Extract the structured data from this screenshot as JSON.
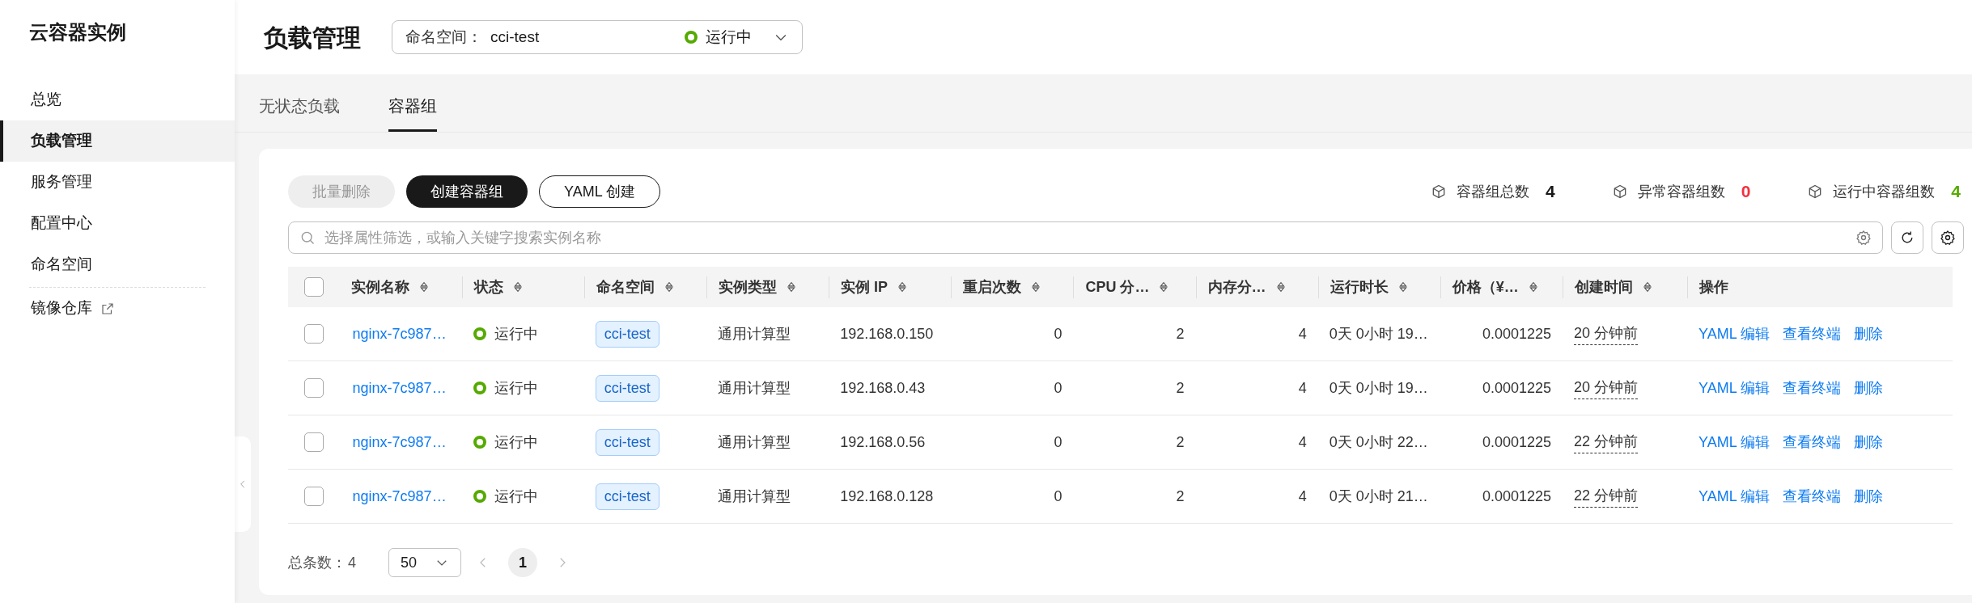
{
  "sidebar": {
    "title": "云容器实例",
    "items": [
      {
        "label": "总览",
        "selected": false,
        "kind": "link"
      },
      {
        "label": "负载管理",
        "selected": true,
        "kind": "link"
      },
      {
        "label": "服务管理",
        "selected": false,
        "kind": "link"
      },
      {
        "label": "配置中心",
        "selected": false,
        "kind": "link"
      },
      {
        "label": "命名空间",
        "selected": false,
        "kind": "link"
      },
      {
        "label": "镜像仓库",
        "selected": false,
        "kind": "external"
      }
    ]
  },
  "header": {
    "title": "负载管理",
    "namespace_select": {
      "label": "命名空间：",
      "value": "cci-test",
      "status": "运行中"
    }
  },
  "tabs": [
    {
      "label": "无状态负载",
      "selected": false
    },
    {
      "label": "容器组",
      "selected": true
    }
  ],
  "toolbar": {
    "buttons": [
      {
        "label": "批量删除",
        "kind": "disabled"
      },
      {
        "label": "创建容器组",
        "kind": "primary"
      },
      {
        "label": "YAML 创建",
        "kind": "outline"
      }
    ],
    "stats": [
      {
        "label": "容器组总数",
        "value": "4",
        "color": "#191919"
      },
      {
        "label": "异常容器组数",
        "value": "0",
        "color": "#f2303f"
      },
      {
        "label": "运行中容器组数",
        "value": "4",
        "color": "#55aa00"
      }
    ]
  },
  "search": {
    "placeholder": "选择属性筛选，或输入关键字搜索实例名称"
  },
  "table": {
    "all_selected": false,
    "columns": [
      "实例名称",
      "状态",
      "命名空间",
      "实例类型",
      "实例 IP",
      "重启次数",
      "CPU 分…",
      "内存分…",
      "运行时长",
      "价格（¥…",
      "创建时间",
      "操作"
    ],
    "rows": [
      {
        "selected": false,
        "name": "nginx-7c987…",
        "status": "运行中",
        "namespace": "cci-test",
        "type": "通用计算型",
        "ip": "192.168.0.150",
        "restarts": "0",
        "cpu": "2",
        "memory": "4",
        "runtime": "0天 0小时 19…",
        "price": "0.0001225",
        "created": "20 分钟前",
        "actions": [
          "YAML 编辑",
          "查看终端",
          "删除"
        ]
      },
      {
        "selected": false,
        "name": "nginx-7c987…",
        "status": "运行中",
        "namespace": "cci-test",
        "type": "通用计算型",
        "ip": "192.168.0.43",
        "restarts": "0",
        "cpu": "2",
        "memory": "4",
        "runtime": "0天 0小时 19…",
        "price": "0.0001225",
        "created": "20 分钟前",
        "actions": [
          "YAML 编辑",
          "查看终端",
          "删除"
        ]
      },
      {
        "selected": false,
        "name": "nginx-7c987…",
        "status": "运行中",
        "namespace": "cci-test",
        "type": "通用计算型",
        "ip": "192.168.0.56",
        "restarts": "0",
        "cpu": "2",
        "memory": "4",
        "runtime": "0天 0小时 22…",
        "price": "0.0001225",
        "created": "22 分钟前",
        "actions": [
          "YAML 编辑",
          "查看终端",
          "删除"
        ]
      },
      {
        "selected": false,
        "name": "nginx-7c987…",
        "status": "运行中",
        "namespace": "cci-test",
        "type": "通用计算型",
        "ip": "192.168.0.128",
        "restarts": "0",
        "cpu": "2",
        "memory": "4",
        "runtime": "0天 0小时 21…",
        "price": "0.0001225",
        "created": "22 分钟前",
        "actions": [
          "YAML 编辑",
          "查看终端",
          "删除"
        ]
      }
    ]
  },
  "pagination": {
    "total_label": "总条数：",
    "total": "4",
    "page_size": "50",
    "current_page": "1"
  }
}
